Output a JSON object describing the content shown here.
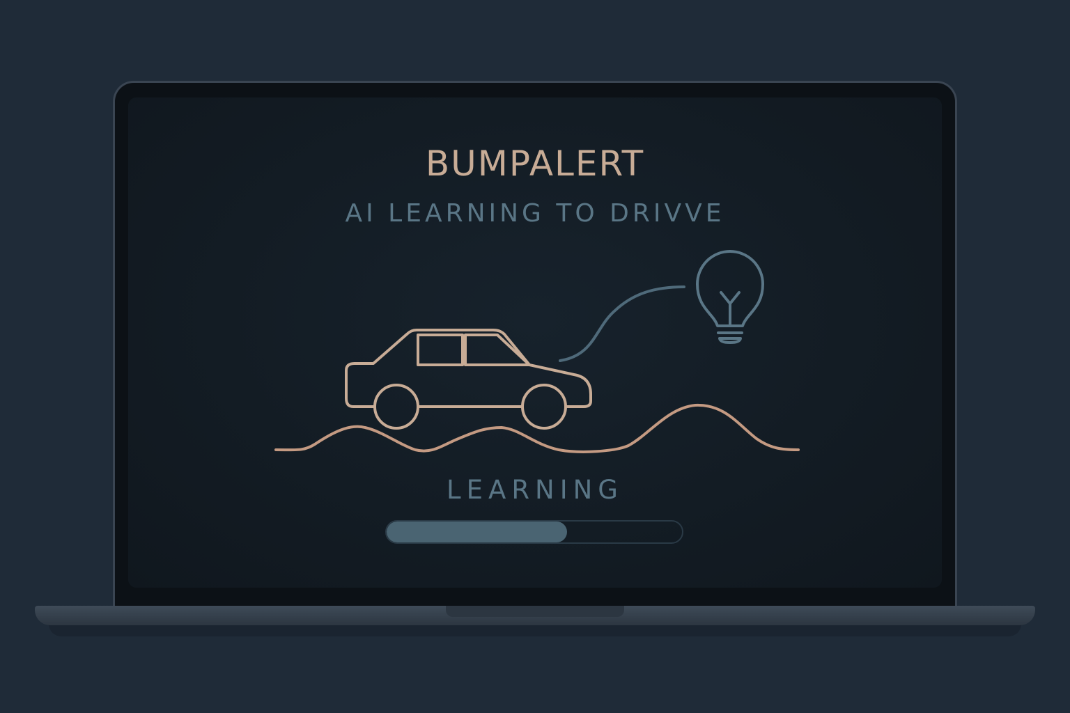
{
  "app": {
    "title": "BUMPALERT",
    "subtitle": "AI LEARNING TO DRIVVE"
  },
  "status": {
    "label": "LEARNING",
    "progress": 0.61
  },
  "icons": [
    "car-icon",
    "road-wave-icon",
    "lightbulb-icon",
    "idea-link-curve"
  ],
  "colors": {
    "background": "#1f2b38",
    "screen": "#131c24",
    "accent_tan": "#c8ac96",
    "road": "#c49a82",
    "accent_blue": "#5a7686",
    "progress_fill": "#4a6472"
  }
}
